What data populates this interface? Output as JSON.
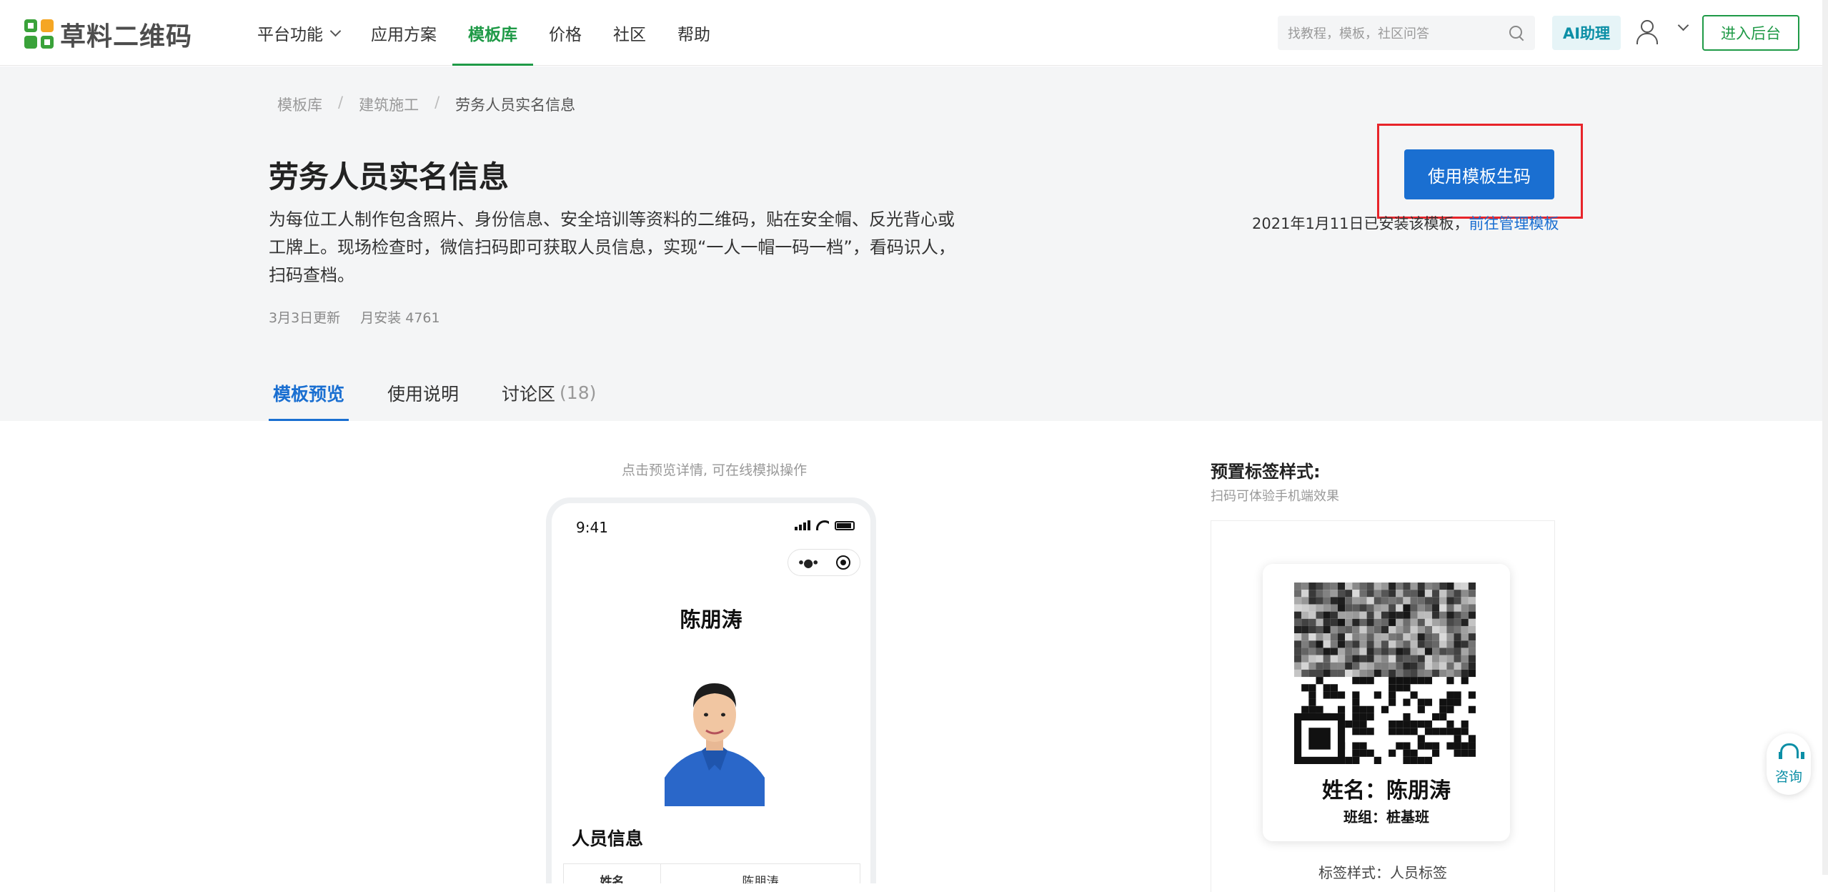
{
  "brand": {
    "name": "草料二维码"
  },
  "nav": {
    "items": [
      {
        "label": "平台功能",
        "has_dropdown": true,
        "active": false
      },
      {
        "label": "应用方案",
        "has_dropdown": false,
        "active": false
      },
      {
        "label": "模板库",
        "has_dropdown": false,
        "active": true
      },
      {
        "label": "价格",
        "has_dropdown": false,
        "active": false
      },
      {
        "label": "社区",
        "has_dropdown": false,
        "active": false
      },
      {
        "label": "帮助",
        "has_dropdown": false,
        "active": false
      }
    ],
    "search_placeholder": "找教程，模板，社区问答",
    "ai_label": "AI助理",
    "console_label": "进入后台",
    "accent_color": "#1f9a47"
  },
  "breadcrumb": [
    "模板库",
    "建筑施工",
    "劳务人员实名信息"
  ],
  "template": {
    "title": "劳务人员实名信息",
    "description": "为每位工人制作包含照片、身份信息、安全培训等资料的二维码，贴在安全帽、反光背心或工牌上。现场检查时，微信扫码即可获取人员信息，实现“一人一帽一码一档”，看码识人，扫码查档。",
    "updated": "3月3日更新",
    "monthly_installs": "月安装 4761",
    "use_button": "使用模板生码",
    "installed_note": "2021年1月11日已安装该模板，",
    "manage_link": "前往管理模板"
  },
  "tabs": [
    {
      "label": "模板预览",
      "active": true,
      "count": ""
    },
    {
      "label": "使用说明",
      "active": false,
      "count": ""
    },
    {
      "label": "讨论区",
      "active": false,
      "count": "(18)"
    }
  ],
  "preview": {
    "hint": "点击预览详情, 可在线模拟操作",
    "phone_time": "9:41",
    "person_name": "陈朋涛",
    "section_title": "人员信息",
    "table_row": {
      "label": "姓名",
      "value": "陈朋涛"
    }
  },
  "label_style": {
    "title": "预置标签样式:",
    "subtitle": "扫码可体验手机端效果",
    "card_name": "姓名：陈朋涛",
    "card_team": "班组：桩基班",
    "caption": "标签样式：人员标签"
  },
  "consult": {
    "label": "咨询"
  },
  "colors": {
    "primary_blue": "#1a6fd1",
    "highlight_red": "#e8242a",
    "teal": "#0c8fa6"
  }
}
